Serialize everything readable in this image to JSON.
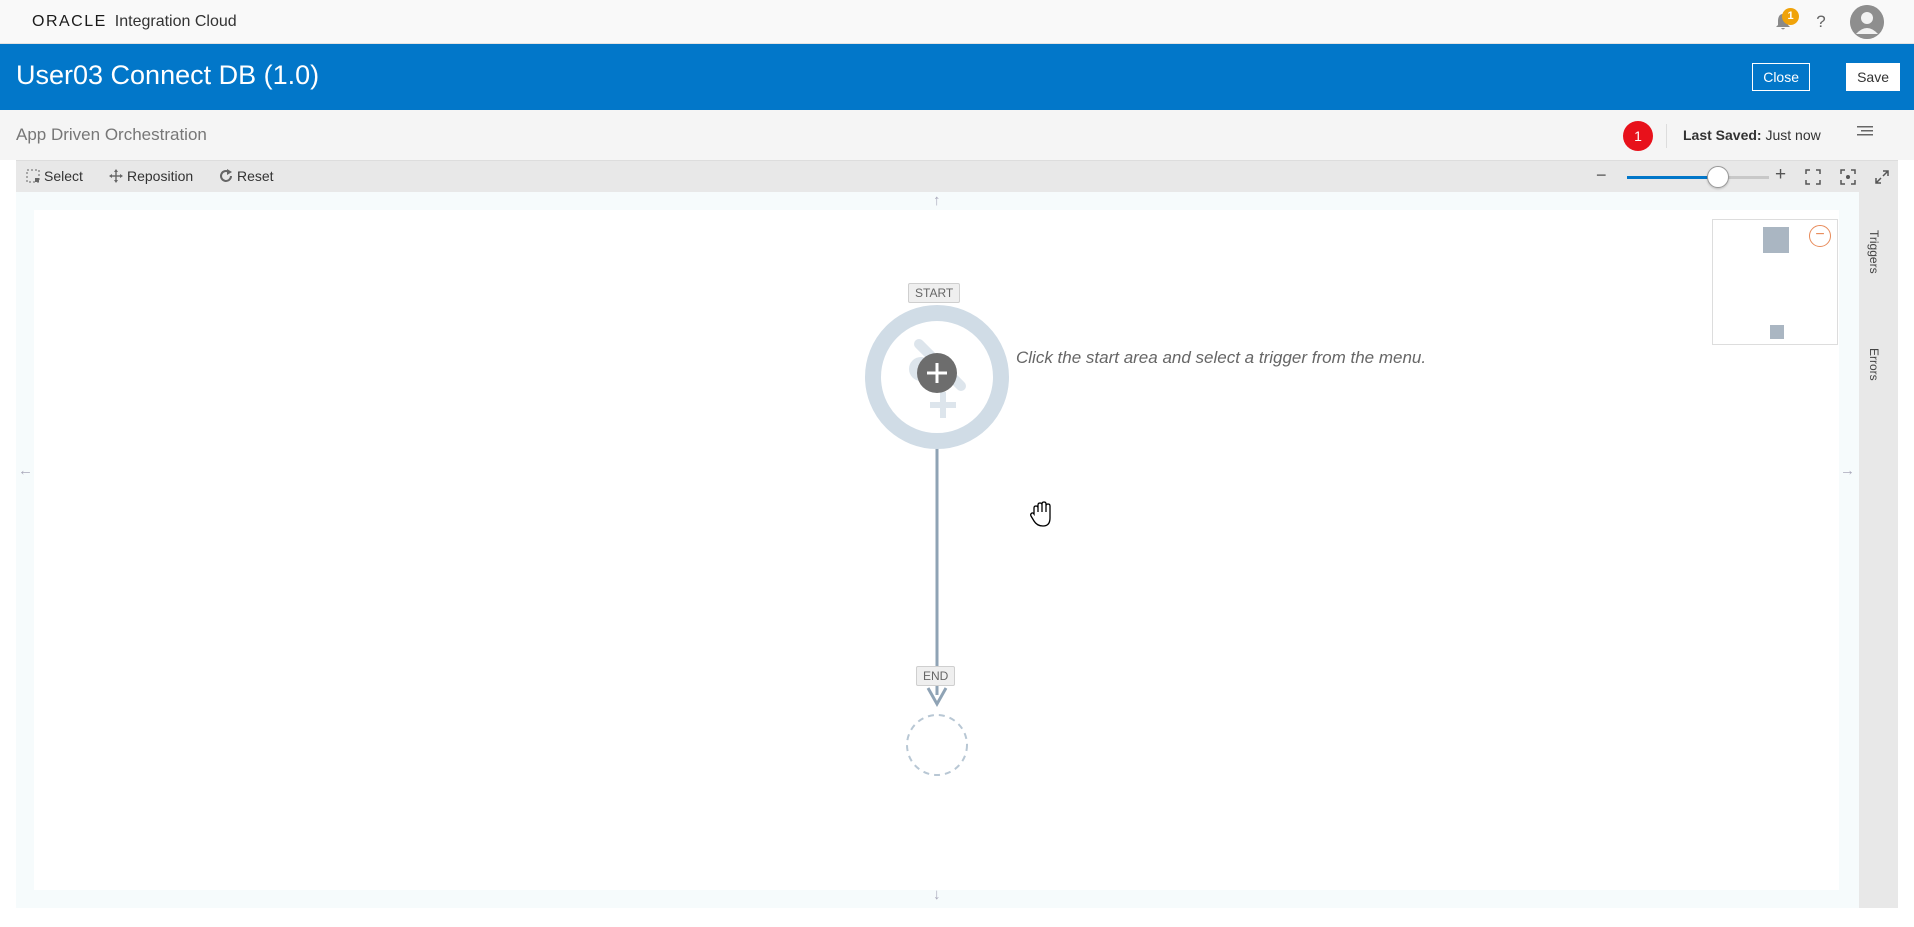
{
  "header": {
    "logo_text": "ORACLE",
    "product_name": "Integration Cloud",
    "notifications_count": "1",
    "help_glyph": "?"
  },
  "titlebar": {
    "title": "User03 Connect DB (1.0)",
    "close_label": "Close",
    "save_label": "Save"
  },
  "subheader": {
    "pattern_label": "App Driven Orchestration",
    "error_count": "1",
    "last_saved_label": "Last Saved:",
    "last_saved_value": "Just now"
  },
  "toolbar": {
    "select_label": "Select",
    "reposition_label": "Reposition",
    "reset_label": "Reset",
    "zoom_minus": "−",
    "zoom_plus": "+",
    "zoom_level": 0.64
  },
  "canvas": {
    "start_label": "START",
    "end_label": "END",
    "hint": "Click the start area and select a trigger from the menu.",
    "arrow_up": "↑",
    "arrow_down": "↓",
    "arrow_left": "←",
    "arrow_right": "→"
  },
  "sidepanel": {
    "triggers_label": "Triggers",
    "errors_label": "Errors"
  },
  "colors": {
    "brand_blue": "#0277c9",
    "error_red": "#e8111b",
    "notify_orange": "#f0a30a"
  }
}
